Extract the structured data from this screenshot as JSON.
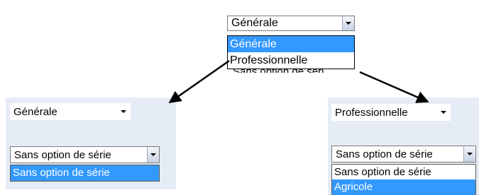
{
  "top": {
    "select_value": "Générale",
    "options": [
      "Générale",
      "Professionnelle"
    ],
    "selected_option": "Générale",
    "obscured_text": "Sans option de séri"
  },
  "left": {
    "voie_value": "Générale",
    "option_value": "Sans option de série",
    "options": [
      "Sans option de série"
    ],
    "selected_option": "Sans option de série"
  },
  "right": {
    "voie_value": "Professionnelle",
    "option_value": "Sans option de série",
    "options": [
      "Sans option de série",
      "Agricole"
    ],
    "selected_option": "Agricole"
  },
  "colors": {
    "panel": "#e6ecf5",
    "highlight": "#3399ff",
    "arrow": "#000000"
  },
  "icons": [
    "dropdown-arrow-icon",
    "pointer-arrow-icon"
  ]
}
